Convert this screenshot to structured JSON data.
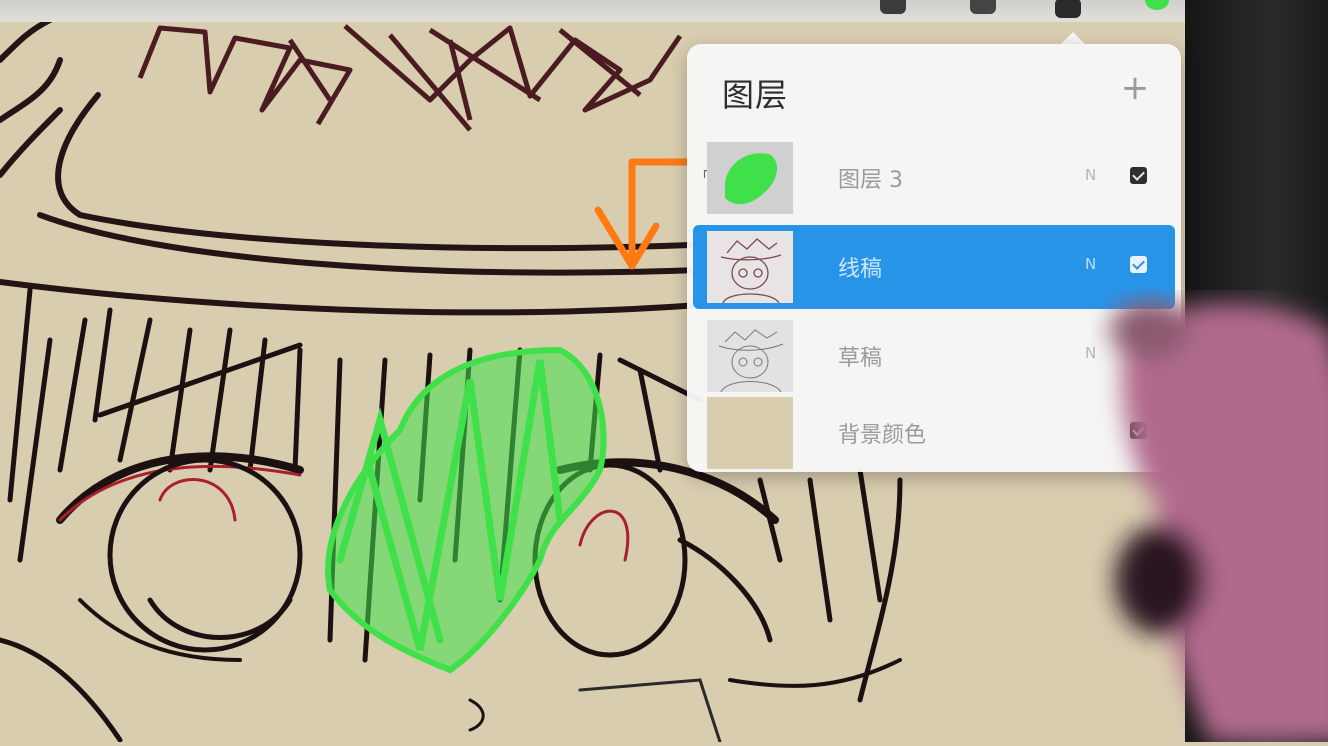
{
  "panel": {
    "title": "图层",
    "add_icon": "plus-icon",
    "layers": [
      {
        "name": "图层 3",
        "blend_mode": "N",
        "visible": true,
        "clipping": true,
        "selected": false,
        "thumb": "green-blob"
      },
      {
        "name": "线稿",
        "blend_mode": "N",
        "visible": true,
        "clipping": false,
        "selected": true,
        "thumb": "line-sketch"
      },
      {
        "name": "草稿",
        "blend_mode": "N",
        "visible": false,
        "clipping": false,
        "selected": false,
        "thumb": "rough-sketch"
      },
      {
        "name": "背景颜色",
        "blend_mode": "",
        "visible": true,
        "clipping": false,
        "selected": false,
        "thumb": "solid-color"
      }
    ]
  },
  "colors": {
    "canvas_bg": "#d9cdb0",
    "selected_layer": "#2894e8",
    "ink": "#1f1414",
    "red_ink": "#a8202e",
    "green_stroke": "#3fe04a",
    "annotation_arrow": "#ff7a12",
    "background_swatch": "#d9cdb0"
  },
  "annotation": {
    "icon": "orange-arrow-icon"
  }
}
